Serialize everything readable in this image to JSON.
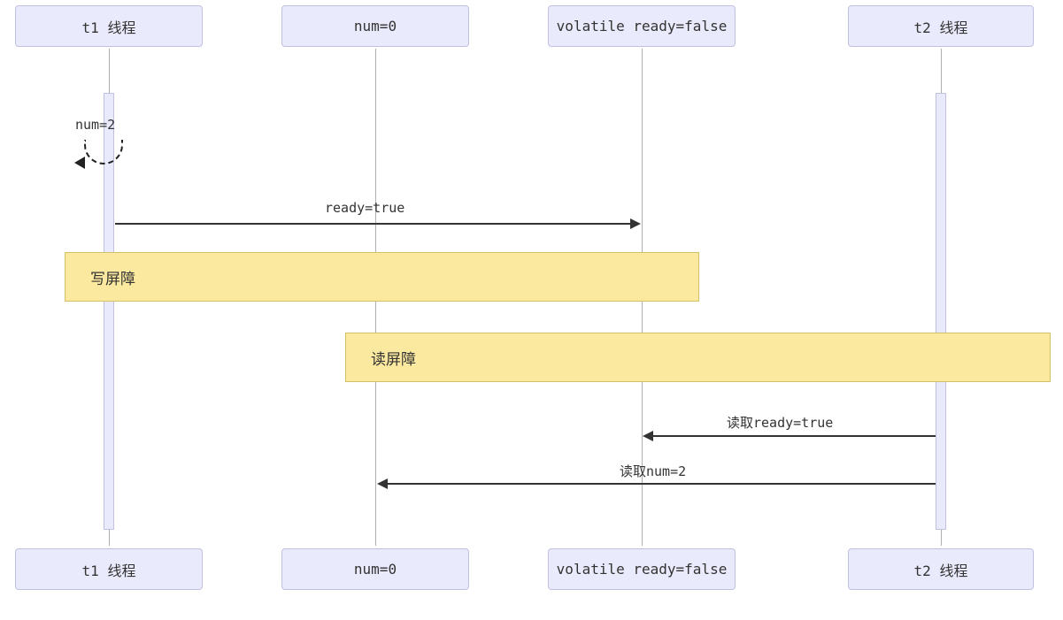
{
  "participants": {
    "p1": "t1 线程",
    "p2": "num=0",
    "p3": "volatile ready=false",
    "p4": "t2 线程"
  },
  "messages": {
    "selfMsg": "num=2",
    "readyTrue": "ready=true",
    "writeBarrier": "写屏障",
    "readBarrier": "读屏障",
    "readReady": "读取ready=true",
    "readNum": "读取num=2"
  },
  "chart_data": {
    "type": "sequence-diagram",
    "participants": [
      {
        "id": "t1",
        "label": "t1 线程"
      },
      {
        "id": "num",
        "label": "num=0"
      },
      {
        "id": "ready",
        "label": "volatile ready=false"
      },
      {
        "id": "t2",
        "label": "t2 线程"
      }
    ],
    "events": [
      {
        "from": "t1",
        "to": "t1",
        "label": "num=2",
        "type": "self"
      },
      {
        "from": "t1",
        "to": "ready",
        "label": "ready=true",
        "type": "message"
      },
      {
        "type": "barrier",
        "label": "写屏障",
        "span": [
          "t1",
          "ready"
        ]
      },
      {
        "type": "barrier",
        "label": "读屏障",
        "span": [
          "num",
          "t2"
        ]
      },
      {
        "from": "t2",
        "to": "ready",
        "label": "读取ready=true",
        "type": "message"
      },
      {
        "from": "t2",
        "to": "num",
        "label": "读取num=2",
        "type": "message"
      }
    ]
  }
}
